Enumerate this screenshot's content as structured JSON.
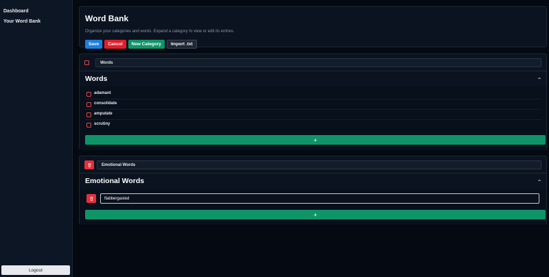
{
  "sidebar": {
    "items": [
      {
        "label": "Dashboard"
      },
      {
        "label": "Your Word Bank"
      }
    ],
    "logout_label": "Logout"
  },
  "header": {
    "title": "Word Bank",
    "subtitle": "Organize your categories and words. Expand a category to view or edit its entries.",
    "buttons": {
      "save": "Save",
      "cancel": "Cancel",
      "new_category": "New Category",
      "import": "Import .txt"
    }
  },
  "categories": [
    {
      "name_value": "Words",
      "title": "Words",
      "words": [
        "adamant",
        "consolidate",
        "amputate",
        "scrutiny"
      ],
      "add_label": "+"
    },
    {
      "name_value": "Emotional Words",
      "title": "Emotional Words",
      "words": [
        "flabbergasted"
      ],
      "add_label": "+"
    }
  ],
  "colors": {
    "save": "#1a7fe0",
    "cancel": "#e21d2a",
    "new_category": "#0f9468",
    "delete": "#e5303b",
    "checkbox_border": "#e5484d"
  },
  "icons": {
    "sidebar_toggle": "sidebar-toggle-icon",
    "trash": "trash-icon",
    "chevron": "chevron-up-icon"
  }
}
